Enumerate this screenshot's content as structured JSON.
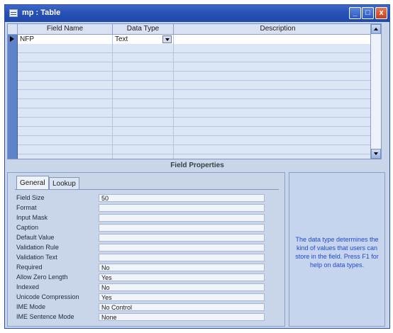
{
  "window": {
    "title": "mp : Table",
    "controls": {
      "minimize": "_",
      "maximize": "□",
      "close": "x"
    }
  },
  "grid": {
    "columns": [
      "Field Name",
      "Data Type",
      "Description"
    ],
    "rows": [
      {
        "field_name": "NFP",
        "data_type": "Text",
        "description": ""
      }
    ],
    "empty_rows": 13
  },
  "field_properties": {
    "label": "Field Properties",
    "tabs": [
      "General",
      "Lookup"
    ],
    "active_tab": "General",
    "properties": [
      {
        "label": "Field Size",
        "value": "50"
      },
      {
        "label": "Format",
        "value": ""
      },
      {
        "label": "Input Mask",
        "value": ""
      },
      {
        "label": "Caption",
        "value": ""
      },
      {
        "label": "Default Value",
        "value": ""
      },
      {
        "label": "Validation Rule",
        "value": ""
      },
      {
        "label": "Validation Text",
        "value": ""
      },
      {
        "label": "Required",
        "value": "No"
      },
      {
        "label": "Allow Zero Length",
        "value": "Yes"
      },
      {
        "label": "Indexed",
        "value": "No"
      },
      {
        "label": "Unicode Compression",
        "value": "Yes"
      },
      {
        "label": "IME Mode",
        "value": "No Control"
      },
      {
        "label": "IME Sentence Mode",
        "value": "None"
      }
    ],
    "help_text": "The data type determines the kind of values that users can store in the field. Press F1 for help on data types."
  },
  "colors": {
    "titlebar": "#2751b5",
    "window_bg": "#c9d6ea",
    "help_text": "#1f4bd0"
  }
}
